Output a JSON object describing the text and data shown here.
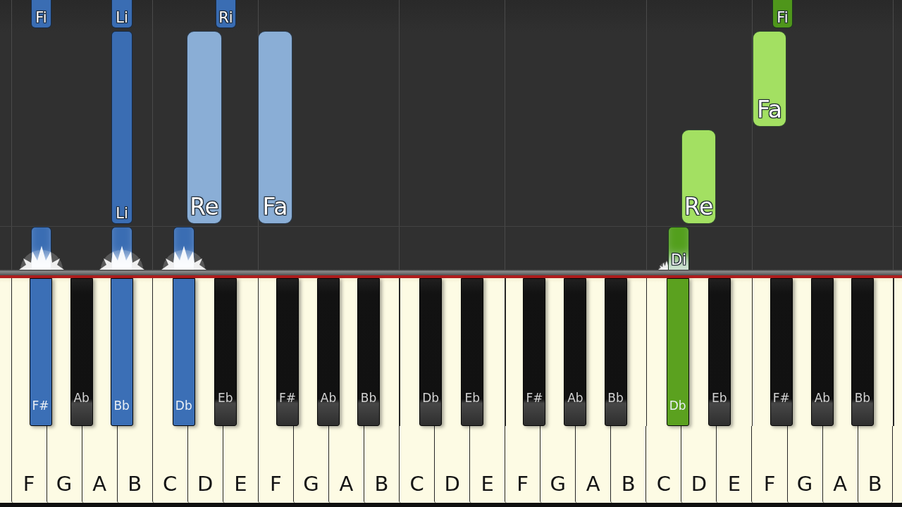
{
  "piano_roll": {
    "notes": [
      {
        "label": "Fi",
        "kind": "sharp",
        "color": "#3a6db3",
        "playing": false
      },
      {
        "label": "Li",
        "kind": "sharp",
        "color": "#3a6db3",
        "playing": false
      },
      {
        "label": "Ri",
        "kind": "sharp",
        "color": "#3a6db3",
        "playing": false
      },
      {
        "label": "Fi",
        "kind": "sharp",
        "color": "#4f961b",
        "playing": false
      },
      {
        "label": "Li",
        "kind": "sharp",
        "color": "#3a6db3",
        "playing": false
      },
      {
        "label": "Re",
        "kind": "natural",
        "color": "#8aaed6",
        "playing": false
      },
      {
        "label": "Fa",
        "kind": "natural",
        "color": "#8aaed6",
        "playing": false
      },
      {
        "label": "Fa",
        "kind": "natural",
        "color": "#a3e062",
        "playing": false
      },
      {
        "label": "Re",
        "kind": "natural",
        "color": "#a3e062",
        "playing": false
      },
      {
        "kind": "sharp",
        "color": "#3a6db3",
        "playing": true
      },
      {
        "kind": "sharp",
        "color": "#3a6db3",
        "playing": true
      },
      {
        "kind": "sharp",
        "color": "#3a6db3",
        "playing": true
      },
      {
        "label": "Di",
        "kind": "sharp",
        "color": "#539f1d",
        "playing": true
      }
    ]
  },
  "keyboard": {
    "white_keys": [
      {
        "label": "F",
        "black_key": {
          "label": "F#",
          "pressed": true,
          "color": "#3b6fb6"
        }
      },
      {
        "label": "G",
        "black_key": {
          "label": "Ab",
          "pressed": false
        }
      },
      {
        "label": "A",
        "black_key": {
          "label": "Bb",
          "pressed": true,
          "color": "#3b6fb6"
        }
      },
      {
        "label": "B"
      },
      {
        "label": "C",
        "black_key": {
          "label": "Db",
          "pressed": true,
          "color": "#3b6fb6"
        }
      },
      {
        "label": "D",
        "black_key": {
          "label": "Eb",
          "pressed": false
        }
      },
      {
        "label": "E"
      },
      {
        "label": "F",
        "black_key": {
          "label": "F#",
          "pressed": false
        }
      },
      {
        "label": "G",
        "black_key": {
          "label": "Ab",
          "pressed": false
        }
      },
      {
        "label": "A",
        "black_key": {
          "label": "Bb",
          "pressed": false
        }
      },
      {
        "label": "B"
      },
      {
        "label": "C",
        "black_key": {
          "label": "Db",
          "pressed": false
        }
      },
      {
        "label": "D",
        "black_key": {
          "label": "Eb",
          "pressed": false
        }
      },
      {
        "label": "E"
      },
      {
        "label": "F",
        "black_key": {
          "label": "F#",
          "pressed": false
        }
      },
      {
        "label": "G",
        "black_key": {
          "label": "Ab",
          "pressed": false
        }
      },
      {
        "label": "A",
        "black_key": {
          "label": "Bb",
          "pressed": false
        }
      },
      {
        "label": "B"
      },
      {
        "label": "C",
        "black_key": {
          "label": "Db",
          "pressed": true,
          "color": "#5ba11f"
        }
      },
      {
        "label": "D",
        "black_key": {
          "label": "Eb",
          "pressed": false
        }
      },
      {
        "label": "E"
      },
      {
        "label": "F",
        "black_key": {
          "label": "F#",
          "pressed": false
        }
      },
      {
        "label": "G",
        "black_key": {
          "label": "Ab",
          "pressed": false
        }
      },
      {
        "label": "A",
        "black_key": {
          "label": "Bb",
          "pressed": false
        }
      },
      {
        "label": "B"
      }
    ]
  }
}
